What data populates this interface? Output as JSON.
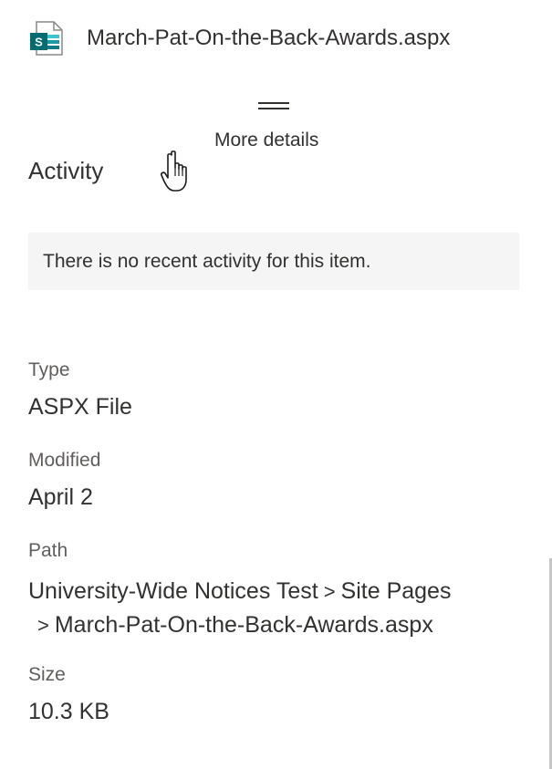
{
  "file": {
    "name": "March-Pat-On-the-Back-Awards.aspx",
    "icon": "sharepoint-page-icon",
    "icon_letter": "S"
  },
  "grip": {
    "tooltip": "More details"
  },
  "activity": {
    "title": "Activity",
    "empty_message": "There is no recent activity for this item."
  },
  "properties": {
    "type": {
      "label": "Type",
      "value": "ASPX File"
    },
    "modified": {
      "label": "Modified",
      "value": "April 2"
    },
    "path": {
      "label": "Path",
      "segments": [
        "University-Wide Notices Test",
        "Site Pages",
        "March-Pat-On-the-Back-Awards.aspx"
      ],
      "separator": ">"
    },
    "size": {
      "label": "Size",
      "value": "10.3 KB"
    }
  },
  "colors": {
    "sharepoint_teal": "#036c70",
    "text": "#323130",
    "label": "#605e5c",
    "activity_bg": "#f5f5f5"
  }
}
